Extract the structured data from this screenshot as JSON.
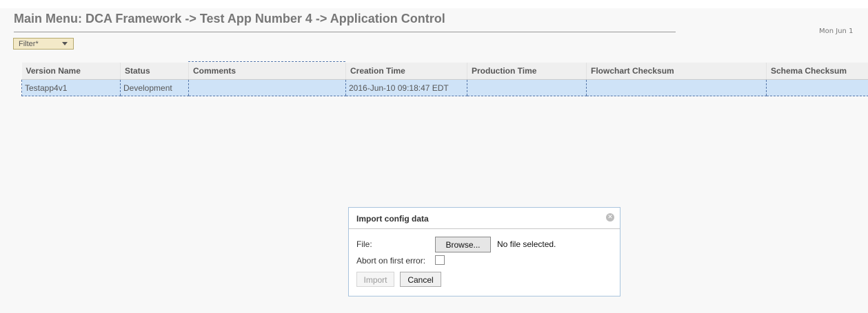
{
  "header": {
    "title": "Main Menu: DCA Framework -> Test App Number 4 -> Application Control",
    "date": "Mon Jun 1"
  },
  "filter": {
    "label": "Filter*"
  },
  "table": {
    "columns": [
      "Version Name",
      "Status",
      "Comments",
      "Creation Time",
      "Production Time",
      "Flowchart Checksum",
      "Schema Checksum"
    ],
    "rows": [
      {
        "cells": [
          "Testapp4v1",
          "Development",
          "",
          "2016-Jun-10 09:18:47 EDT",
          "",
          "",
          ""
        ]
      }
    ]
  },
  "dialog": {
    "title": "Import config data",
    "file_label": "File:",
    "browse_label": "Browse...",
    "no_file_text": "No file selected.",
    "abort_label": "Abort on first error:",
    "import_label": "Import",
    "cancel_label": "Cancel",
    "close_icon": "close-icon"
  },
  "colors": {
    "selected_row": "#cfe3f7",
    "filter_bg": "#f3e9c8",
    "dialog_border": "#a9c4de"
  }
}
